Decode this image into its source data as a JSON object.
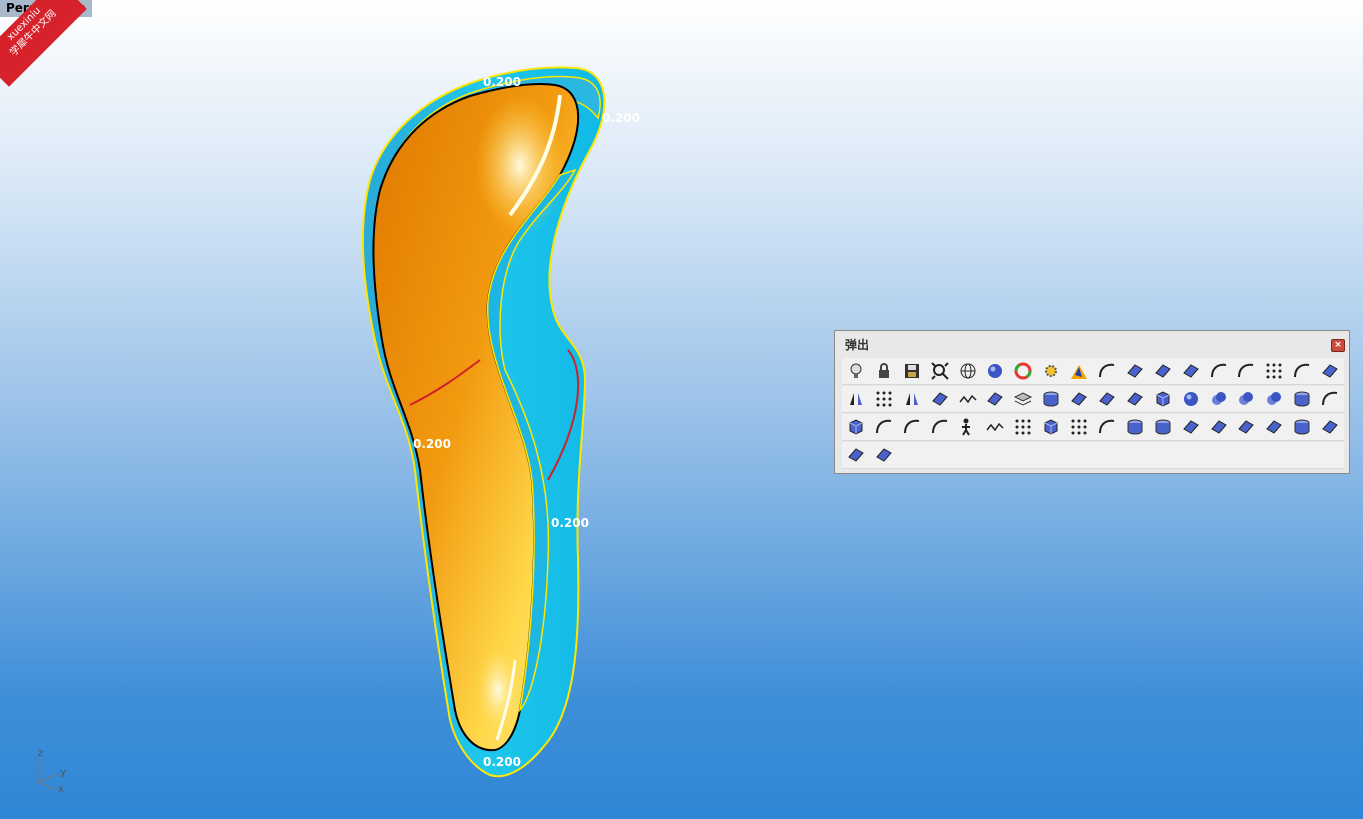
{
  "viewport": {
    "label": "Perspective"
  },
  "watermark": {
    "line1": "xuexiniu",
    "line2": "学犀牛中文网"
  },
  "model": {
    "thickness_labels": [
      "0.200",
      "0.200",
      "0.200",
      "0.200",
      "0.200"
    ],
    "colors": {
      "outer": "#21c0e6",
      "inner": "#f08a00",
      "edge": "#ffe600",
      "seam": "#d0202a"
    }
  },
  "axes": {
    "z": "z",
    "y": "y",
    "x": "x"
  },
  "popup": {
    "title": "弹出",
    "close_glyph": "×",
    "rows": [
      [
        "lightbulb-icon",
        "lock-icon",
        "save-icon",
        "zoom-extents-icon",
        "wireframe-sphere-icon",
        "shaded-sphere-icon",
        "color-wheel-icon",
        "gear-icon",
        "explode-icon",
        "curve-icon",
        "surface-icon",
        "mesh-icon",
        "analysis-icon",
        "dimension-1-icon",
        "dimension-2-icon",
        "points-icon",
        "arch-icon",
        "blend-icon"
      ],
      [
        "mirror-icon",
        "array-icon",
        "align-icon",
        "surface-patch-icon",
        "polyline-icon",
        "circle-icon",
        "layers-icon",
        "cylinder-outline-icon",
        "plane-icon",
        "plane-tilted-icon",
        "circle-surface-icon",
        "box-icon",
        "sphere-icon",
        "boolean-union-icon",
        "boolean-diff-icon",
        "boolean-intersect-icon",
        "ring-icon",
        "pipe-icon"
      ],
      [
        "cube-icon",
        "fillet-curve-icon",
        "s-curve-icon",
        "arc-icon",
        "person-icon",
        "zigzag-icon",
        "vertical-points-icon",
        "extrude-icon",
        "grid-icon",
        "sweep-icon",
        "cylinder-icon",
        "solid-cylinder-icon",
        "revolve-icon",
        "revolve-2-icon",
        "loft-icon",
        "funnel-icon",
        "cap-icon",
        "patch-icon"
      ],
      [
        "flag-surface-icon",
        "plane-small-icon"
      ]
    ]
  }
}
